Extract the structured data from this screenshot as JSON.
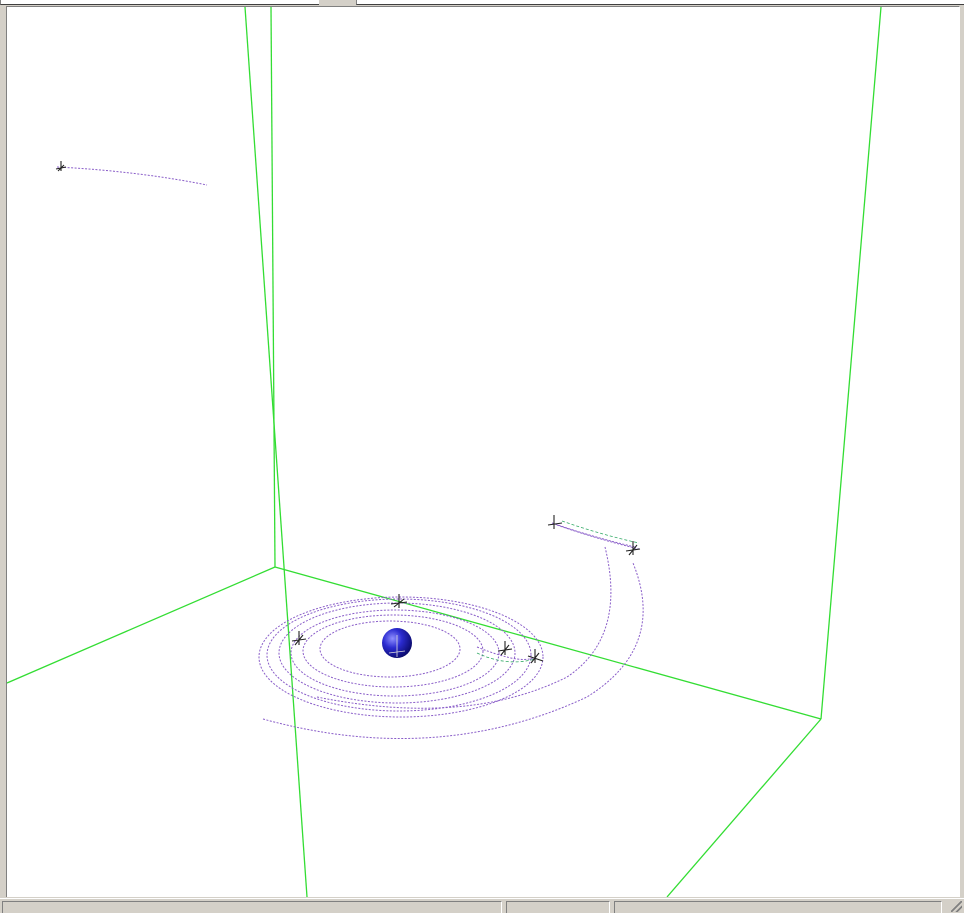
{
  "window": {
    "top_fields": [
      "",
      ""
    ]
  },
  "scene": {
    "bounding_box_color": "#33dd33",
    "trajectory_color": "#8a5ec9",
    "body_color": "#1f1fb8",
    "probe_marker_color": "#222222",
    "central_body": {
      "name": "sphere",
      "icon": "planet-sphere"
    },
    "probe_markers": [
      "crosshair-marker",
      "crosshair-marker",
      "crosshair-marker",
      "crosshair-marker",
      "crosshair-marker",
      "crosshair-marker",
      "crosshair-marker"
    ]
  },
  "statusbar": {
    "panes": [
      "",
      "",
      ""
    ]
  }
}
